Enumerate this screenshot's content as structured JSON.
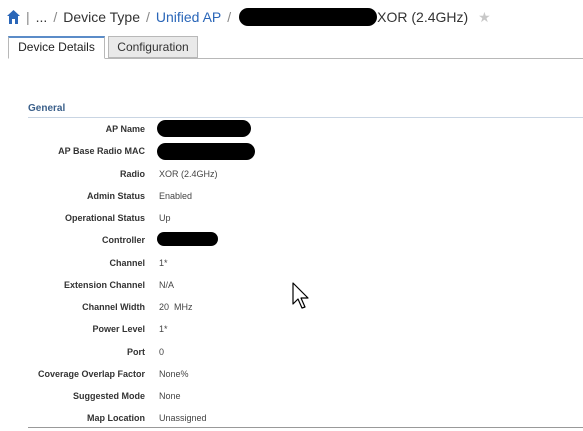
{
  "breadcrumb": {
    "ellipsis": "...",
    "device_type": "Device Type",
    "unified_ap": "Unified AP",
    "separator": "/",
    "ap_suffix": "XOR (2.4GHz)"
  },
  "tabs": [
    {
      "label": "Device Details"
    },
    {
      "label": "Configuration"
    }
  ],
  "section": {
    "title": "General"
  },
  "fields": [
    {
      "label": "AP Name",
      "value": ""
    },
    {
      "label": "AP Base Radio MAC",
      "value": ""
    },
    {
      "label": "Radio",
      "value": "XOR (2.4GHz)"
    },
    {
      "label": "Admin Status",
      "value": "Enabled"
    },
    {
      "label": "Operational Status",
      "value": "Up"
    },
    {
      "label": "Controller",
      "value": ""
    },
    {
      "label": "Channel",
      "value": "1*"
    },
    {
      "label": "Extension Channel",
      "value": "N/A"
    },
    {
      "label": "Channel Width",
      "value": "20  MHz"
    },
    {
      "label": "Power Level",
      "value": "1*"
    },
    {
      "label": "Port",
      "value": "0"
    },
    {
      "label": "Coverage Overlap Factor",
      "value": "None%"
    },
    {
      "label": "Suggested Mode",
      "value": "None"
    },
    {
      "label": "Map Location",
      "value": "Unassigned"
    }
  ],
  "icons": {
    "home": "home-icon",
    "favorite": "star-icon",
    "pointer": "cursor-icon"
  },
  "colors": {
    "link": "#2a66b8",
    "section_title": "#3a5f8a"
  }
}
